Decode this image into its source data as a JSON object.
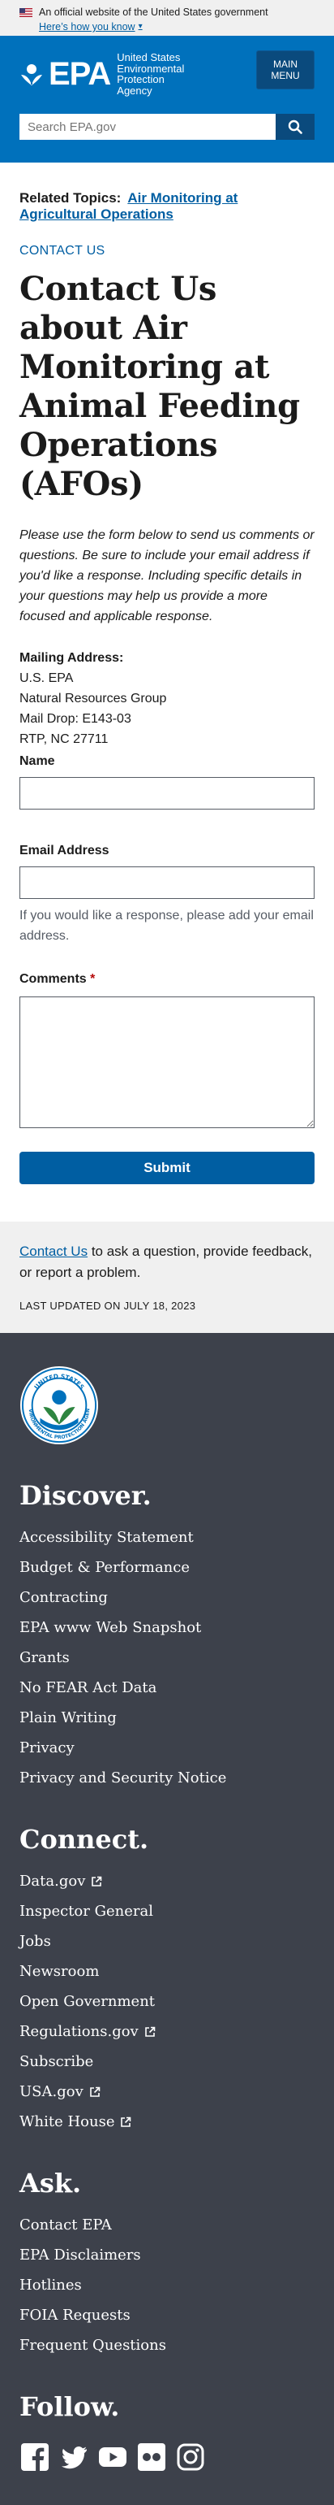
{
  "gov_banner": {
    "text": "An official website of the United States government",
    "link": "Here’s how you know"
  },
  "header": {
    "logo_word": "EPA",
    "logo_lines": [
      "United States",
      "Environmental Protection",
      "Agency"
    ],
    "menu_lines": [
      "MAIN",
      "MENU"
    ],
    "search_placeholder": "Search EPA.gov"
  },
  "main": {
    "related_label": "Related Topics:",
    "related_link": "Air Monitoring at Agricultural Operations",
    "eyebrow": "CONTACT US",
    "title": "Contact Us about Air Monitoring at Animal Feeding Operations (AFOs)",
    "intro": "Please use the form below to send us comments or questions. Be sure to include your email address if you'd like a response. Including specific details in your questions may help us provide a more focused and applicable response.",
    "mailing": {
      "label": "Mailing Address:",
      "lines": [
        "U.S. EPA",
        "Natural Resources Group",
        "Mail Drop: E143-03",
        "RTP, NC 27711"
      ]
    },
    "form": {
      "name_label": "Name",
      "email_label": "Email Address",
      "email_hint": "If you would like a response, please add your email address.",
      "comments_label": "Comments",
      "required_mark": "*",
      "submit_label": "Submit"
    }
  },
  "contact_strip": {
    "link": "Contact Us",
    "text": " to ask a question, provide feedback, or report a problem.",
    "updated": "LAST UPDATED ON JULY 18, 2023"
  },
  "footer": {
    "discover": {
      "heading": "Discover.",
      "items": [
        "Accessibility Statement",
        "Budget & Performance",
        "Contracting",
        "EPA www Web Snapshot",
        "Grants",
        "No FEAR Act Data",
        "Plain Writing",
        "Privacy",
        "Privacy and Security Notice"
      ]
    },
    "connect": {
      "heading": "Connect.",
      "items": [
        "Data.gov",
        "Inspector General",
        "Jobs",
        "Newsroom",
        "Open Government",
        "Regulations.gov",
        "Subscribe",
        "USA.gov",
        "White House"
      ]
    },
    "ask": {
      "heading": "Ask.",
      "items": [
        "Contact EPA",
        "EPA Disclaimers",
        "Hotlines",
        "FOIA Requests",
        "Frequent Questions"
      ]
    },
    "follow": {
      "heading": "Follow.",
      "icons": [
        "facebook-icon",
        "twitter-icon",
        "youtube-icon",
        "flickr-icon",
        "instagram-icon"
      ]
    }
  },
  "colors": {
    "header_blue": "#0071bc",
    "link_blue": "#005ea2",
    "footer_gray": "#3d414b"
  }
}
